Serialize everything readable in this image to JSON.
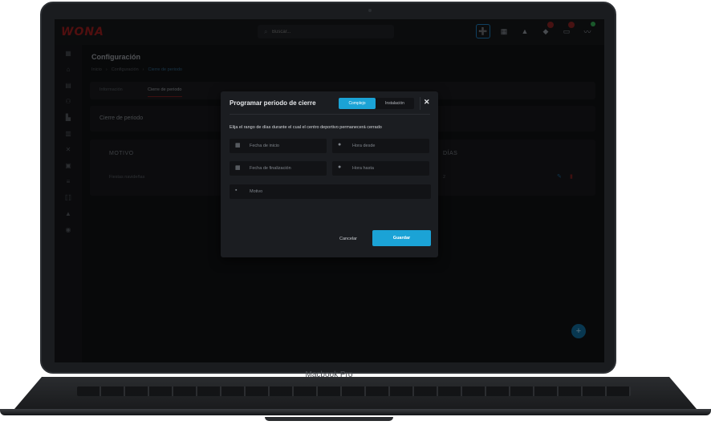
{
  "device": {
    "brand_label": "Macbook Pro"
  },
  "app": {
    "logo_text": "WONA",
    "search": {
      "placeholder": "Buscar..."
    },
    "top_icons": [
      "add-user-icon",
      "calendar-icon",
      "graduation-cap-icon",
      "bell-icon",
      "id-card-icon",
      "activity-icon"
    ]
  },
  "sidebar": {
    "items": [
      "dashboard-icon",
      "home-icon",
      "calendar-icon",
      "users-icon",
      "building-icon",
      "store-icon",
      "tools-icon",
      "contact-icon",
      "list-icon",
      "code-icon",
      "graduation-cap-icon",
      "broadcast-icon"
    ]
  },
  "page": {
    "title": "Configuración",
    "breadcrumb": [
      "Inicio",
      "Configuración",
      "Cierre de periodo"
    ],
    "tabs": [
      "Información",
      "Cierre de periodo"
    ],
    "section_title": "Cierre de periodo",
    "table": {
      "headers": [
        "MOTIVO",
        "DÍAS"
      ],
      "rows": [
        {
          "motivo": "Fiestas navideñas",
          "dias": "2"
        }
      ]
    }
  },
  "modal": {
    "title": "Programar periodo de cierre",
    "segment": {
      "options": [
        "Complejo",
        "Instalación"
      ],
      "selected": "Complejo"
    },
    "close_label": "✕",
    "description": "Elija el rango de días durante el cual el centro deportivo permanecerá cerrado",
    "fields": {
      "fecha_inicio": "Fecha de inicio",
      "hora_desde": "Hora desde",
      "fecha_fin": "Fecha de finalización",
      "hora_hasta": "Hora hasta",
      "motivo": "Motivo"
    },
    "cancel_label": "Cancelar",
    "save_label": "Guardar"
  },
  "colors": {
    "accent": "#1ba3d6",
    "brand": "#8a1a1a",
    "modal_bg": "#1b1d21"
  }
}
